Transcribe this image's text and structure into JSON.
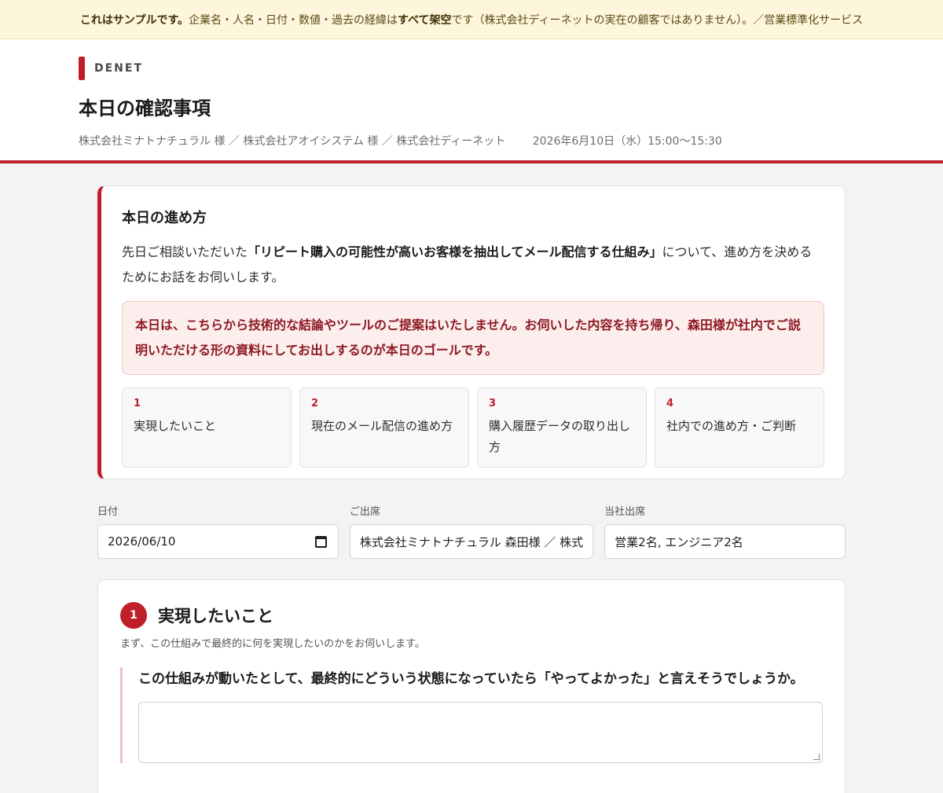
{
  "banner": {
    "lead": "これはサンプルです。",
    "text1": "企業名・人名・日付・数値・過去の経緯は",
    "emphasis": "すべて架空",
    "text2": "です（株式会社ディーネットの実在の顧客ではありません）。／営業標準化サービス"
  },
  "header": {
    "brand": "DENET",
    "title": "本日の確認事項",
    "parties": "株式会社ミナトナチュラル 様 ／ 株式会社アオイシステム 様 ／ 株式会社ディーネット",
    "datetime": "2026年6月10日（水）15:00〜15:30"
  },
  "intro": {
    "title": "本日の進め方",
    "text_before": "先日ご相談いただいた",
    "text_bold": "「リピート購入の可能性が高いお客様を抽出してメール配信する仕組み」",
    "text_after": "について、進め方を決めるためにお話をお伺いします。",
    "goal": "本日は、こちらから技術的な結論やツールのご提案はいたしません。お伺いした内容を持ち帰り、森田様が社内でご説明いただける形の資料にしてお出しするのが本日のゴールです。",
    "steps": [
      {
        "num": "1",
        "label": "実現したいこと"
      },
      {
        "num": "2",
        "label": "現在のメール配信の進め方"
      },
      {
        "num": "3",
        "label": "購入履歴データの取り出し方"
      },
      {
        "num": "4",
        "label": "社内での進め方・ご判断"
      }
    ]
  },
  "fields": {
    "date_label": "日付",
    "date_value": "2026/06/10",
    "attendees_label": "ご出席",
    "attendees_value": "株式会社ミナトナチュラル 森田様 ／ 株式",
    "our_label": "当社出席",
    "our_value": "営業2名, エンジニア2名"
  },
  "section1": {
    "num": "1",
    "title": "実現したいこと",
    "subtitle": "まず、この仕組みで最終的に何を実現したいのかをお伺いします。",
    "question": "この仕組みが動いたとして、最終的にどういう状態になっていたら「やってよかった」と言えそうでしょうか。",
    "answer": ""
  },
  "icons": {
    "calendar": "calendar-icon"
  },
  "colors": {
    "accent": "#c01f2a",
    "banner_bg": "#fdf6dd",
    "goal_bg": "#fdeeee"
  }
}
